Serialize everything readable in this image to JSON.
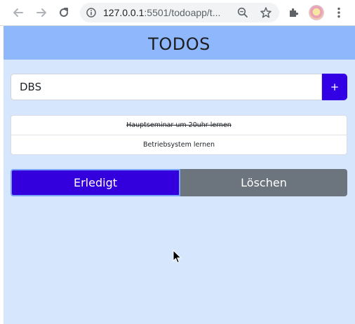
{
  "browser": {
    "url_host": "127.0.0.1",
    "url_rest": ":5501/todoapp/t..."
  },
  "app": {
    "title": "TODOS",
    "input_value": "DBS",
    "add_label": "+",
    "todos": [
      {
        "text": "Hauptseminar um 20uhr lernen",
        "done": true
      },
      {
        "text": "Betriebsystem lernen",
        "done": false
      }
    ],
    "done_label": "Erledigt",
    "delete_label": "Löschen"
  },
  "colors": {
    "header": "#8eb8fb",
    "background": "#d6e6fd",
    "primary": "#3300dd",
    "secondary": "#6c757d"
  }
}
